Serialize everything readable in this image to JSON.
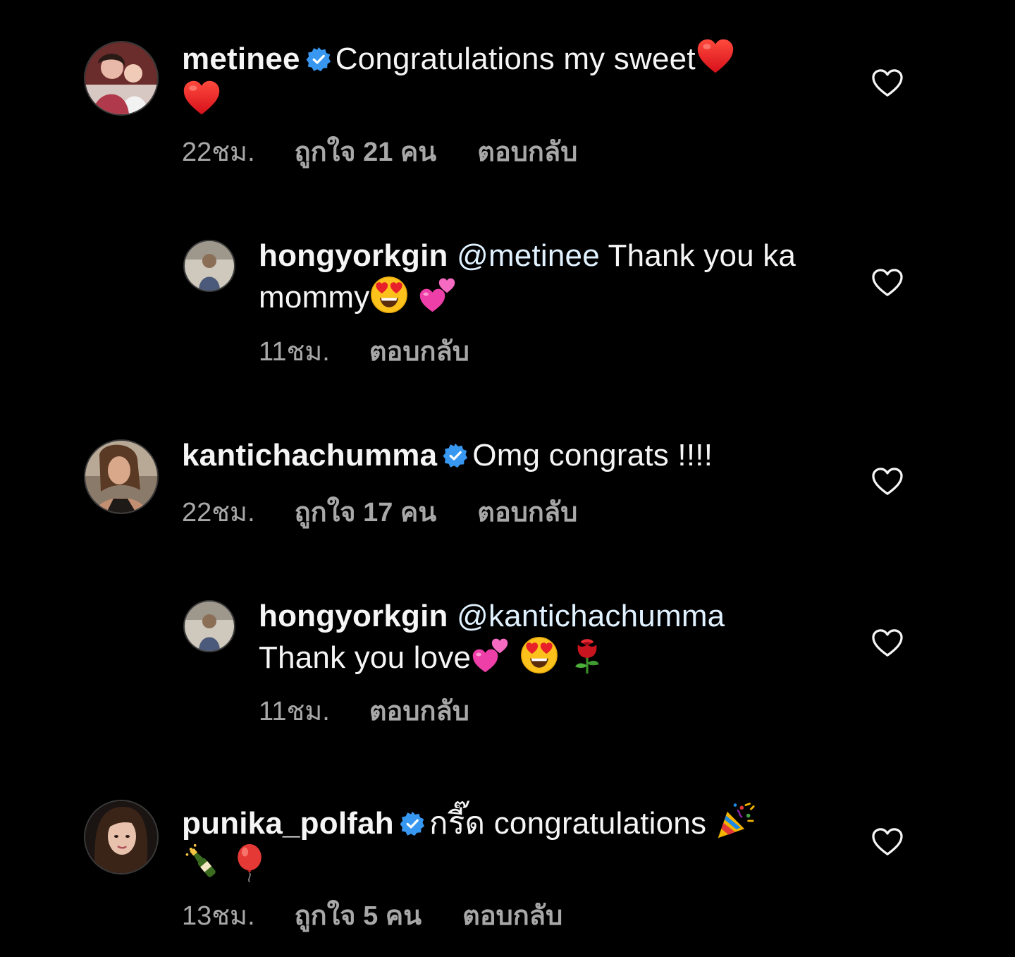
{
  "comments": [
    {
      "username": "metinee",
      "verified": true,
      "mention": "",
      "text": "Congratulations my sweet",
      "emoji_line": [
        "red-heart",
        "red-heart"
      ],
      "time": "22ชม.",
      "likes": "ถูกใจ 21 คน",
      "reply": "ตอบกลับ"
    },
    {
      "username": "hongyorkgin",
      "verified": false,
      "mention": "@metinee",
      "text": "Thank you ka mommy",
      "emoji_line": [
        "heart-eyes",
        "two-hearts"
      ],
      "time": "11ชม.",
      "likes": "",
      "reply": "ตอบกลับ"
    },
    {
      "username": "kantichachumma",
      "verified": true,
      "mention": "",
      "text": "Omg congrats !!!!",
      "emoji_line": [],
      "time": "22ชม.",
      "likes": "ถูกใจ 17 คน",
      "reply": "ตอบกลับ"
    },
    {
      "username": "hongyorkgin",
      "verified": false,
      "mention": "@kantichachumma",
      "text": "Thank you love",
      "emoji_line": [
        "two-hearts",
        "heart-eyes",
        "rose"
      ],
      "time": "11ชม.",
      "likes": "",
      "reply": "ตอบกลับ"
    },
    {
      "username": "punika_polfah",
      "verified": true,
      "mention": "",
      "text": "กรี๊ด congratulations",
      "emoji_line": [
        "party-popper",
        "champagne",
        "balloon"
      ],
      "time": "13ชม.",
      "likes": "ถูกใจ 5 คน",
      "reply": "ตอบกลับ"
    }
  ],
  "colors": {
    "background": "#000000",
    "text": "#f5f5f5",
    "meta": "#a8a8a8",
    "verified_badge": "#3897f0"
  }
}
